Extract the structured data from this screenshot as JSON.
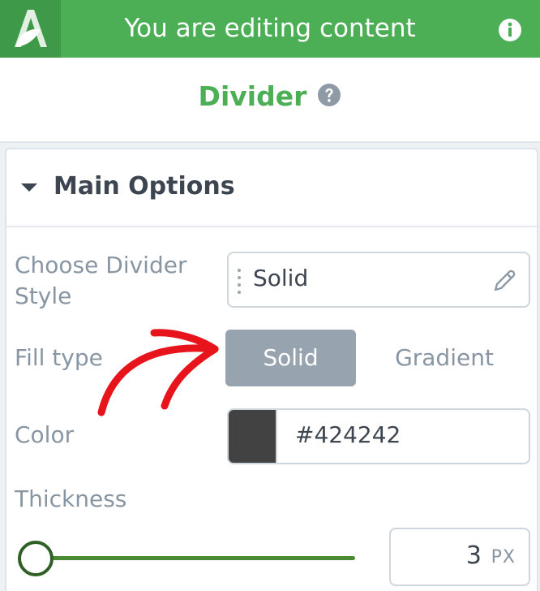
{
  "header": {
    "title": "You are editing content",
    "logo_icon": "leaf-a-logo",
    "info_icon": "info-icon",
    "background": "#4caf56"
  },
  "block": {
    "title": "Divider",
    "help_icon": "help-icon",
    "title_color": "#4caf56"
  },
  "section": {
    "title": "Main Options",
    "expanded": true
  },
  "fields": {
    "divider_style": {
      "label": "Choose Divider Style",
      "value": "Solid"
    },
    "fill_type": {
      "label": "Fill type",
      "options": [
        "Solid",
        "Gradient"
      ],
      "selected": "Solid"
    },
    "color": {
      "label": "Color",
      "value": "#424242"
    },
    "thickness": {
      "label": "Thickness",
      "value": "3",
      "unit": "PX",
      "slider_fraction": 0.03
    }
  },
  "annotation": {
    "type": "red-arrow",
    "color": "#e8141c",
    "points_to": "fill-type-solid"
  }
}
